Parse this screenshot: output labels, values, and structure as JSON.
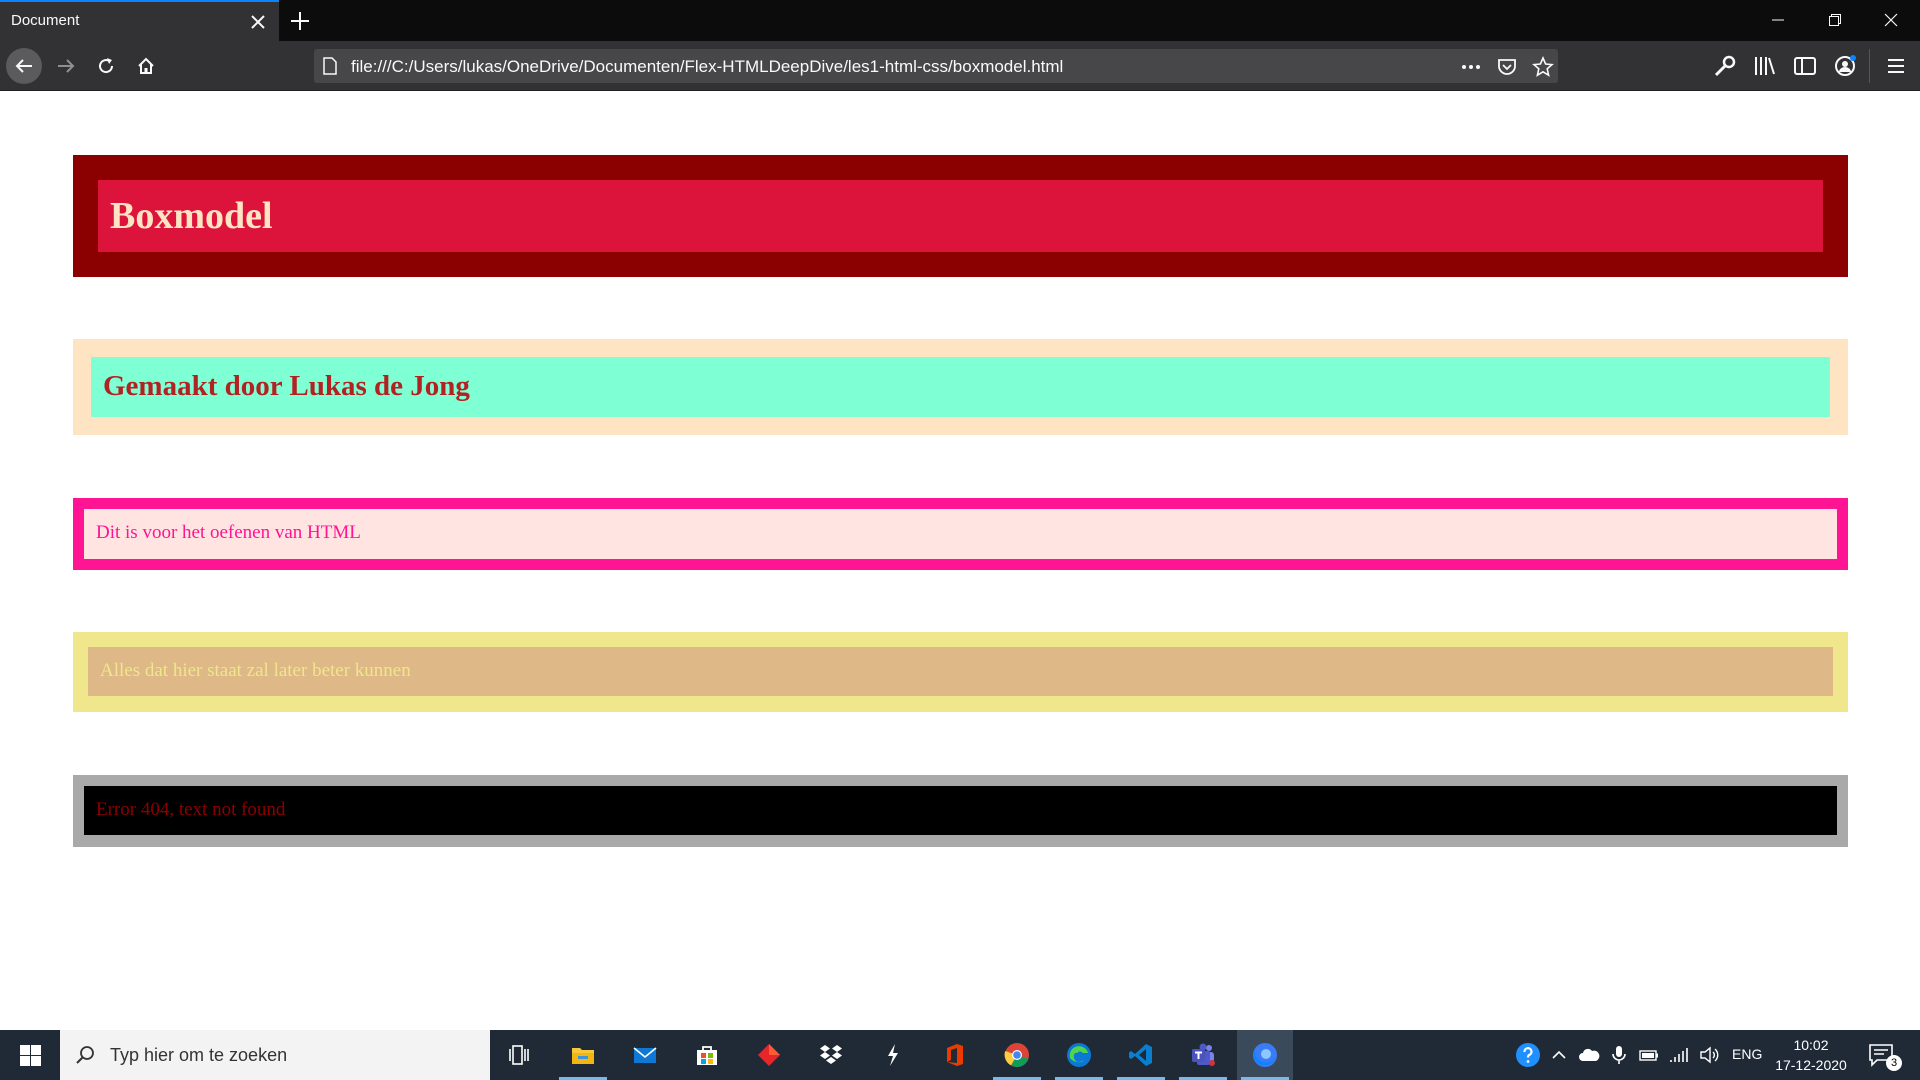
{
  "browser": {
    "tab_title": "Document",
    "url": "file:///C:/Users/lukas/OneDrive/Documenten/Flex-HTMLDeepDive/les1-html-css/boxmodel.html",
    "accent_color": "#0a84ff"
  },
  "page": {
    "boxes": [
      {
        "text": "Boxmodel",
        "outer_color": "#8b0000",
        "inner_color": "#dc143c",
        "text_color": "#ffe4c4"
      },
      {
        "text": "Gemaakt door Lukas de Jong",
        "outer_color": "#ffe4c4",
        "inner_color": "#7fffd4",
        "text_color": "#b22222"
      },
      {
        "text": "Dit is voor het oefenen van HTML",
        "outer_color": "#ff1493",
        "inner_color": "#ffe4e1",
        "text_color": "#ff1493"
      },
      {
        "text": "Alles dat hier staat zal later beter kunnen",
        "outer_color": "#f0e68c",
        "inner_color": "#deb887",
        "text_color": "#f0e68c"
      },
      {
        "text": "Error 404, text not found",
        "outer_color": "#a9a9a9",
        "inner_color": "#000000",
        "text_color": "#8b0000"
      }
    ]
  },
  "taskbar": {
    "search_placeholder": "Typ hier om te zoeken",
    "apps": [
      "task-view-icon",
      "file-explorer-icon",
      "mail-icon",
      "store-icon",
      "red-app-icon",
      "dropbox-icon",
      "bolt-app-icon",
      "office-icon",
      "chrome-icon",
      "edge-icon",
      "vscode-icon",
      "teams-icon",
      "firefox-icon"
    ],
    "language": "ENG",
    "time": "10:02",
    "date": "17-12-2020",
    "notification_count": "3"
  }
}
